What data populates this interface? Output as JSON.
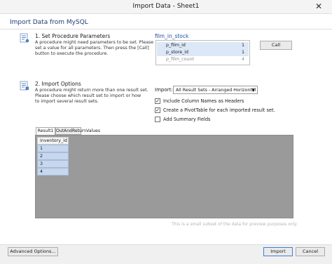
{
  "window": {
    "title": "Import Data - Sheet1",
    "close_glyph": "✕"
  },
  "header": {
    "title": "Import Data from MySQL"
  },
  "step1": {
    "title": "1. Set Procedure Parameters",
    "desc_lines": [
      "A procedure might need parameters to be set. Please",
      "set a value for all parameters. Then press the [Call]",
      "button to execute the procedure."
    ],
    "icon": "procedure-parameters-icon"
  },
  "procedure": {
    "name": "film_in_stock",
    "params": [
      {
        "name": "p_film_id",
        "value": "1"
      },
      {
        "name": "p_store_id",
        "value": "1"
      },
      {
        "name": "p_film_count",
        "value": "4"
      }
    ],
    "call_label": "Call"
  },
  "step2": {
    "title": "2. Import Options",
    "desc_lines": [
      "A procedure might return more than one result set.",
      "Please choose which result set to import or how",
      "to import several result sets."
    ],
    "icon": "import-options-icon"
  },
  "import_options": {
    "import_label": "Import:",
    "selected": "All Result Sets - Arranged Horizontal",
    "options": [
      {
        "label": "Include Column Names as Headers",
        "checked": true
      },
      {
        "label": "Create a PivotTable for each imported result set.",
        "checked": true
      },
      {
        "label": "Add Summary Fields",
        "checked": false
      }
    ]
  },
  "tabs": [
    {
      "label": "Result1",
      "active": true
    },
    {
      "label": "OutAndReturnValues",
      "active": false
    }
  ],
  "grid": {
    "column": "inventory_id",
    "rows": [
      "1",
      "2",
      "3",
      "4"
    ]
  },
  "note": "This is a small subset of the data for preview purposes only.",
  "footer": {
    "advanced_label": "Advanced Options...",
    "import_label": "Import",
    "cancel_label": "Cancel"
  },
  "colors": {
    "title_blue": "#1e3d7b",
    "link_blue": "#1e4e9c",
    "grid_bg": "#9a9a9a",
    "cell_blue": "#c6d7ee"
  }
}
